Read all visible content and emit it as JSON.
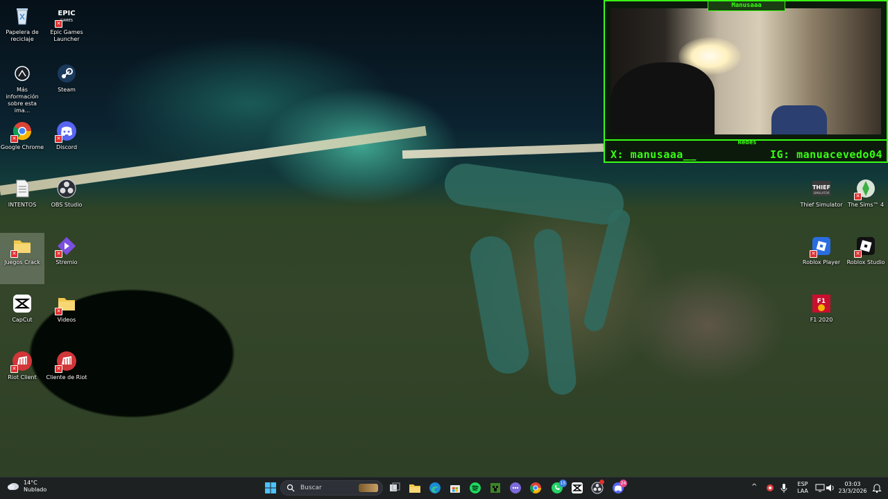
{
  "desktop": {
    "icons_left": [
      {
        "name": "recycle-bin-icon",
        "label": "Papelera de reciclaje"
      },
      {
        "name": "epic-games-icon",
        "label": "Epic Games Launcher"
      },
      {
        "name": "info-icon",
        "label": "Más información sobre esta ima..."
      },
      {
        "name": "steam-icon",
        "label": "Steam"
      },
      {
        "name": "chrome-icon",
        "label": "Google Chrome"
      },
      {
        "name": "discord-icon",
        "label": "Discord"
      },
      {
        "name": "text-file-icon",
        "label": "INTENTOS"
      },
      {
        "name": "obs-icon",
        "label": "OBS Studio"
      },
      {
        "name": "folder-icon",
        "label": "Juegos Crack"
      },
      {
        "name": "stremio-icon",
        "label": "Stremio"
      },
      {
        "name": "capcut-icon",
        "label": "CapCut"
      },
      {
        "name": "folder-icon",
        "label": "Videos"
      },
      {
        "name": "riot-icon",
        "label": "Riot Client"
      },
      {
        "name": "riot-icon",
        "label": "Cliente de Riot"
      }
    ],
    "icons_right": [
      {
        "name": "thief-simulator-icon",
        "label": "Thief Simulator"
      },
      {
        "name": "sims4-icon",
        "label": "The Sims™ 4"
      },
      {
        "name": "roblox-player-icon",
        "label": "Roblox Player"
      },
      {
        "name": "roblox-studio-icon",
        "label": "Roblox Studio"
      },
      {
        "name": "f1-2020-icon",
        "label": "F1 2020"
      }
    ]
  },
  "overlay": {
    "title": "Manusaaa",
    "redes": "Redes",
    "x_handle": "X: manusaaa__",
    "ig_handle": "IG: manuacevedo04",
    "accent": "#39ff14"
  },
  "taskbar": {
    "weather_temp": "14°C",
    "weather_desc": "Nublado",
    "search_placeholder": "Buscar",
    "lang_top": "ESP",
    "lang_bottom": "LAA",
    "time": "03:03",
    "date": "23/3/2026",
    "whatsapp_badge": "15",
    "discord_badge": "24"
  }
}
